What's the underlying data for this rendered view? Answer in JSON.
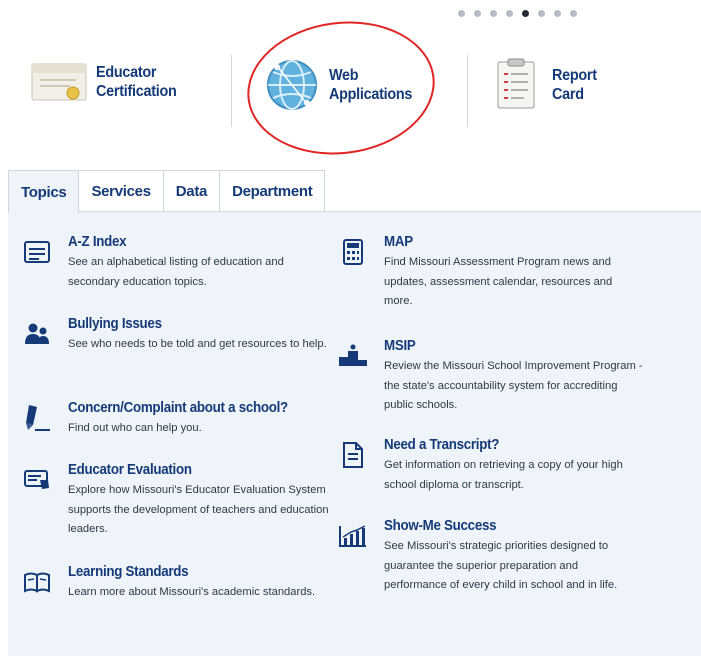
{
  "carousel": {
    "dot_count": 8,
    "active_index": 4
  },
  "tiles": [
    {
      "label": "Educator\nCertification",
      "icon": "certificate-icon"
    },
    {
      "label": "Web\nApplications",
      "icon": "globe-network-icon"
    },
    {
      "label": "Report\nCard",
      "icon": "report-card-icon"
    }
  ],
  "tabs": [
    {
      "label": "Topics",
      "active": true
    },
    {
      "label": "Services",
      "active": false
    },
    {
      "label": "Data",
      "active": false
    },
    {
      "label": "Department",
      "active": false
    }
  ],
  "topics_left": [
    {
      "title": "A-Z Index",
      "desc": "See an alphabetical listing of education and secondary education topics.",
      "icon": "index-list-icon"
    },
    {
      "title": "Bullying Issues",
      "desc": "See who needs to be told and get resources to help.",
      "icon": "people-icon"
    },
    {
      "title": "Concern/Complaint about a school?",
      "desc": "Find out who can help you.",
      "icon": "pencil-icon"
    },
    {
      "title": "Educator Evaluation",
      "desc": "Explore how Missouri's Educator Evaluation System supports the development of teachers and education leaders.",
      "icon": "evaluation-icon"
    },
    {
      "title": "Learning Standards",
      "desc": "Learn more about Missouri's academic standards.",
      "icon": "open-book-icon"
    }
  ],
  "topics_right": [
    {
      "title": "MAP",
      "desc": "Find Missouri Assessment Program news and updates, assessment calendar, resources and more.",
      "icon": "calculator-icon"
    },
    {
      "title": "MSIP",
      "desc": "Review the Missouri School Improvement Program - the state's accountability system for accrediting public schools.",
      "icon": "podium-icon"
    },
    {
      "title": "Need a Transcript?",
      "desc": "Get information on retrieving a copy of your high school diploma or transcript.",
      "icon": "transcript-icon"
    },
    {
      "title": "Show-Me Success",
      "desc": "See Missouri's strategic priorities designed to guarantee the superior preparation and performance of every child in school and in life.",
      "icon": "bar-chart-icon"
    }
  ],
  "colors": {
    "title": "#163a78",
    "panel_bg": "#eef4f9",
    "highlight": "#e02424"
  }
}
